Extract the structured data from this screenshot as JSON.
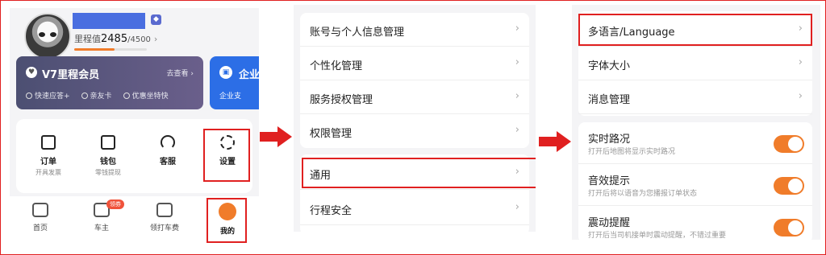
{
  "profile": {
    "mileage_label": "里程值",
    "mileage_value": "2485",
    "mileage_total": "/4500",
    "mileage_progress": 0.552
  },
  "vip": {
    "title": "V7里程会员",
    "link": "去查看",
    "perks": [
      "快速应答+",
      "亲友卡",
      "优惠坐特快"
    ]
  },
  "enterprise": {
    "title": "企业",
    "sub": "企业支"
  },
  "services": [
    {
      "label": "订单",
      "sub": "开具发票",
      "icon": "order-icon"
    },
    {
      "label": "钱包",
      "sub": "零钱提现",
      "icon": "wallet-icon"
    },
    {
      "label": "客服",
      "sub": "",
      "icon": "headset-icon"
    },
    {
      "label": "设置",
      "sub": "",
      "icon": "gear-icon"
    }
  ],
  "tabbar": [
    {
      "label": "首页",
      "icon": "home-icon"
    },
    {
      "label": "车主",
      "icon": "car-icon",
      "badge": "领券"
    },
    {
      "label": "领打车费",
      "icon": "gift-icon"
    },
    {
      "label": "我的",
      "icon": "profile-icon"
    }
  ],
  "settings": {
    "group1": [
      "账号与个人信息管理",
      "个性化管理",
      "服务授权管理",
      "权限管理"
    ],
    "group2": [
      "通用",
      "行程安全"
    ]
  },
  "general": {
    "group1": [
      "多语言/Language",
      "字体大小",
      "消息管理"
    ],
    "toggles": [
      {
        "title": "实时路况",
        "desc": "打开后地图将显示实时路况"
      },
      {
        "title": "音效提示",
        "desc": "打开后将以语音为您播报订单状态"
      },
      {
        "title": "震动提醒",
        "desc": "打开后当司机接单时震动提醒，不错过重要"
      }
    ]
  },
  "chevron": "›",
  "colors": {
    "accent": "#f07c2a",
    "highlight": "#e02020",
    "vip": "#4c4f72",
    "enterprise": "#2c6ee6"
  }
}
